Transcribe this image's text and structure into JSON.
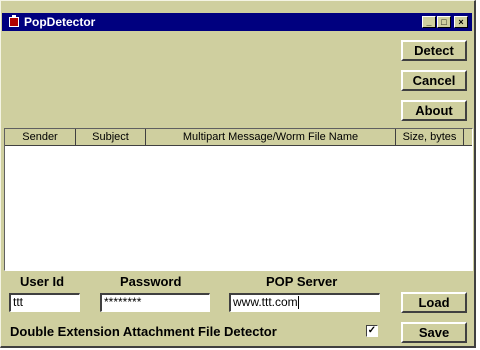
{
  "window": {
    "title": "PopDetector",
    "title_icon": "app-icon",
    "controls": {
      "minimize": "_",
      "maximize": "□",
      "close": "×"
    }
  },
  "buttons": {
    "detect": "Detect",
    "cancel": "Cancel",
    "about": "About",
    "load": "Load",
    "save": "Save"
  },
  "list": {
    "columns": [
      "Sender",
      "Subject",
      "Multipart Message/Worm File Name",
      "Size, bytes"
    ],
    "rows": []
  },
  "form": {
    "user_id_label": "User Id",
    "password_label": "Password",
    "server_label": "POP Server",
    "user_id_value": "ttt",
    "password_value": "********",
    "server_value": "www.ttt.com"
  },
  "option": {
    "label": "Double Extension Attachment File Detector",
    "checked": true,
    "check_mark": "✓"
  },
  "colors": {
    "title_bar": "#00007f",
    "face": "#cfcf9f"
  }
}
